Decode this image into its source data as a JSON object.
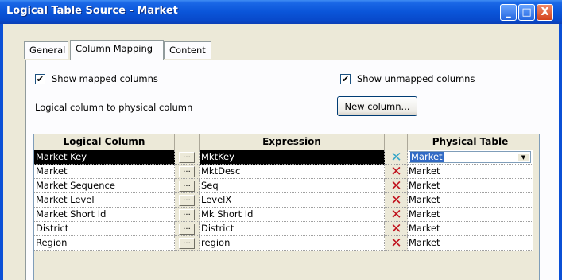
{
  "window": {
    "title": "Logical Table Source - Market",
    "buttons": {
      "minimize": "_",
      "maximize": "□",
      "close": "X"
    }
  },
  "tabs": [
    {
      "label": "General",
      "active": false
    },
    {
      "label": "Column Mapping",
      "active": true
    },
    {
      "label": "Content",
      "active": false
    }
  ],
  "options": {
    "show_mapped": {
      "label": "Show mapped columns",
      "checked": true,
      "mark": "✔"
    },
    "show_unmapped": {
      "label": "Show unmapped columns",
      "checked": true,
      "mark": "✔"
    }
  },
  "description": "Logical column to physical column",
  "new_column_button": "New column...",
  "grid": {
    "headers": {
      "logical": "Logical Column",
      "dots": "",
      "expression": "Expression",
      "x": "",
      "physical": "Physical Table"
    },
    "dots_label": "...",
    "delete_mark": "✕",
    "dropdown_arrow": "▼",
    "rows": [
      {
        "logical": "Market Key",
        "expression": "MktKey",
        "physical": "Market",
        "selected": true
      },
      {
        "logical": "Market",
        "expression": "MktDesc",
        "physical": "Market",
        "selected": false
      },
      {
        "logical": "Market Sequence",
        "expression": "Seq",
        "physical": "Market",
        "selected": false
      },
      {
        "logical": "Market Level",
        "expression": "LevelX",
        "physical": "Market",
        "selected": false
      },
      {
        "logical": "Market Short Id",
        "expression": "Mk Short Id",
        "physical": "Market",
        "selected": false
      },
      {
        "logical": "District",
        "expression": "District",
        "physical": "Market",
        "selected": false
      },
      {
        "logical": "Region",
        "expression": "region",
        "physical": "Market",
        "selected": false
      }
    ]
  },
  "colors": {
    "title_bar": "#0a55d9",
    "selection": "#000000",
    "delete_mark": "#c0141e"
  }
}
